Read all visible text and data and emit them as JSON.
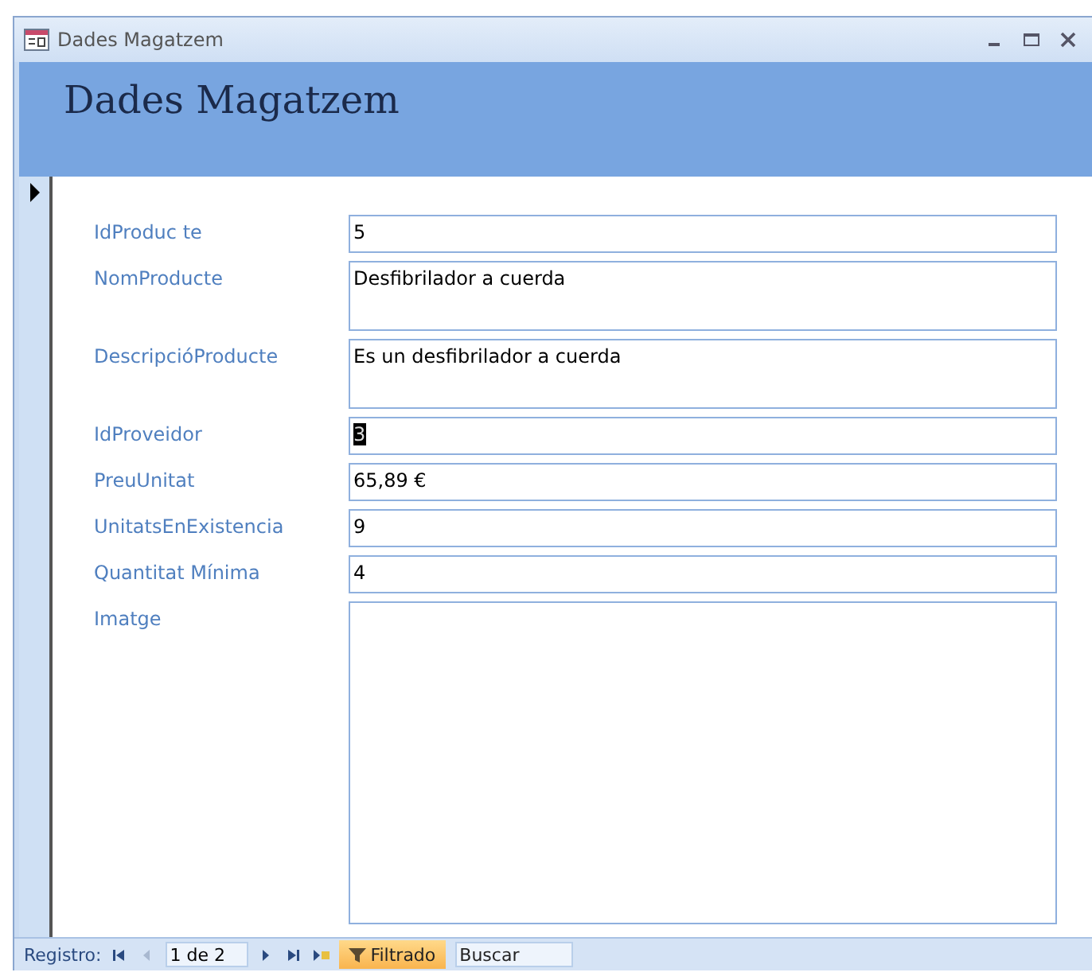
{
  "window": {
    "title": "Dades Magatzem"
  },
  "header": {
    "title": "Dades Magatzem"
  },
  "fields": [
    {
      "label": "IdProduc te",
      "value": "5",
      "kind": "line",
      "selected": false
    },
    {
      "label": "NomProducte",
      "value": "Desfibrilador a cuerda",
      "kind": "box",
      "selected": false
    },
    {
      "label": "DescripcióProducte",
      "value": "Es un desfibrilador a cuerda",
      "kind": "box",
      "selected": false
    },
    {
      "label": "IdProveidor",
      "value": "3",
      "kind": "line",
      "selected": true
    },
    {
      "label": "PreuUnitat",
      "value": "65,89 €",
      "kind": "line",
      "selected": false
    },
    {
      "label": "UnitatsEnExistencia",
      "value": "9",
      "kind": "line",
      "selected": false
    },
    {
      "label": "Quantitat Mínima",
      "value": "4",
      "kind": "line",
      "selected": false
    },
    {
      "label": "Imatge",
      "kind": "image"
    }
  ],
  "status_bar": {
    "label": "Registro:",
    "record": "1 de 2",
    "nav": [
      {
        "kind": "first",
        "disabled": false
      },
      {
        "kind": "prev",
        "disabled": true
      },
      {
        "kind": "next",
        "disabled": false
      },
      {
        "kind": "last",
        "disabled": false
      },
      {
        "kind": "new",
        "disabled": false
      }
    ],
    "filter": {
      "label": "Filtrado",
      "on": true
    },
    "search": {
      "placeholder": "Buscar"
    }
  }
}
